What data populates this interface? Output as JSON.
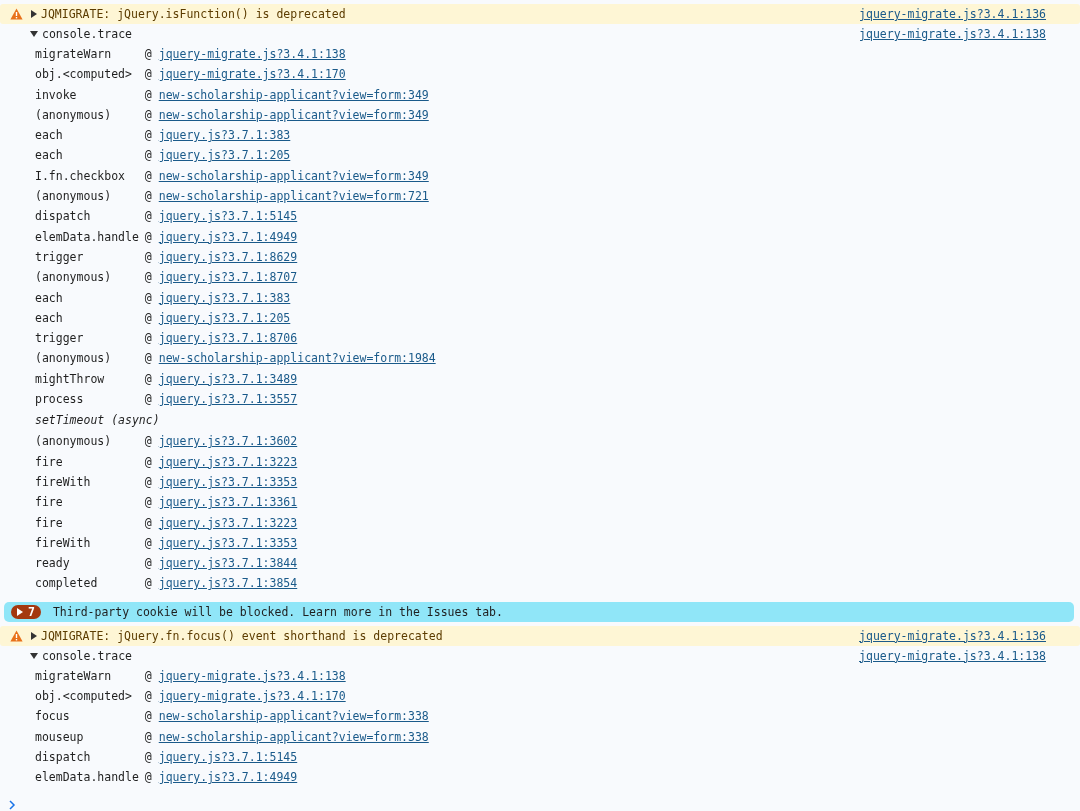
{
  "console_messages": [
    {
      "kind": "warning",
      "expanded": false,
      "message": "JQMIGRATE: jQuery.isFunction() is deprecated",
      "source": "jquery-migrate.js?3.4.1:136",
      "trace": {
        "label": "console.trace",
        "expanded": true,
        "source": "jquery-migrate.js?3.4.1:138",
        "frames": [
          {
            "kind": "frame",
            "function": "migrateWarn",
            "at": "@",
            "link": "jquery-migrate.js?3.4.1:138"
          },
          {
            "kind": "frame",
            "function": "obj.<computed>",
            "at": "@",
            "link": "jquery-migrate.js?3.4.1:170"
          },
          {
            "kind": "frame",
            "function": "invoke",
            "at": "@",
            "link": "new-scholarship-applicant?view=form:349"
          },
          {
            "kind": "frame",
            "function": "(anonymous)",
            "at": "@",
            "link": "new-scholarship-applicant?view=form:349"
          },
          {
            "kind": "frame",
            "function": "each",
            "at": "@",
            "link": "jquery.js?3.7.1:383"
          },
          {
            "kind": "frame",
            "function": "each",
            "at": "@",
            "link": "jquery.js?3.7.1:205"
          },
          {
            "kind": "frame",
            "function": "I.fn.checkbox",
            "at": "@",
            "link": "new-scholarship-applicant?view=form:349"
          },
          {
            "kind": "frame",
            "function": "(anonymous)",
            "at": "@",
            "link": "new-scholarship-applicant?view=form:721"
          },
          {
            "kind": "frame",
            "function": "dispatch",
            "at": "@",
            "link": "jquery.js?3.7.1:5145"
          },
          {
            "kind": "frame",
            "function": "elemData.handle",
            "at": "@",
            "link": "jquery.js?3.7.1:4949"
          },
          {
            "kind": "frame",
            "function": "trigger",
            "at": "@",
            "link": "jquery.js?3.7.1:8629"
          },
          {
            "kind": "frame",
            "function": "(anonymous)",
            "at": "@",
            "link": "jquery.js?3.7.1:8707"
          },
          {
            "kind": "frame",
            "function": "each",
            "at": "@",
            "link": "jquery.js?3.7.1:383"
          },
          {
            "kind": "frame",
            "function": "each",
            "at": "@",
            "link": "jquery.js?3.7.1:205"
          },
          {
            "kind": "frame",
            "function": "trigger",
            "at": "@",
            "link": "jquery.js?3.7.1:8706"
          },
          {
            "kind": "frame",
            "function": "(anonymous)",
            "at": "@",
            "link": "new-scholarship-applicant?view=form:1984"
          },
          {
            "kind": "frame",
            "function": "mightThrow",
            "at": "@",
            "link": "jquery.js?3.7.1:3489"
          },
          {
            "kind": "frame",
            "function": "process",
            "at": "@",
            "link": "jquery.js?3.7.1:3557"
          },
          {
            "kind": "async",
            "function": "setTimeout (async)"
          },
          {
            "kind": "frame",
            "function": "(anonymous)",
            "at": "@",
            "link": "jquery.js?3.7.1:3602"
          },
          {
            "kind": "frame",
            "function": "fire",
            "at": "@",
            "link": "jquery.js?3.7.1:3223"
          },
          {
            "kind": "frame",
            "function": "fireWith",
            "at": "@",
            "link": "jquery.js?3.7.1:3353"
          },
          {
            "kind": "frame",
            "function": "fire",
            "at": "@",
            "link": "jquery.js?3.7.1:3361"
          },
          {
            "kind": "frame",
            "function": "fire",
            "at": "@",
            "link": "jquery.js?3.7.1:3223"
          },
          {
            "kind": "frame",
            "function": "fireWith",
            "at": "@",
            "link": "jquery.js?3.7.1:3353"
          },
          {
            "kind": "frame",
            "function": "ready",
            "at": "@",
            "link": "jquery.js?3.7.1:3844"
          },
          {
            "kind": "frame",
            "function": "completed",
            "at": "@",
            "link": "jquery.js?3.7.1:3854"
          }
        ]
      }
    },
    {
      "kind": "issue",
      "count": "7",
      "message": "Third-party cookie will be blocked. Learn more in the Issues tab."
    },
    {
      "kind": "warning",
      "expanded": false,
      "message": "JQMIGRATE: jQuery.fn.focus() event shorthand is deprecated",
      "source": "jquery-migrate.js?3.4.1:136",
      "trace": {
        "label": "console.trace",
        "expanded": true,
        "source": "jquery-migrate.js?3.4.1:138",
        "frames": [
          {
            "kind": "frame",
            "function": "migrateWarn",
            "at": "@",
            "link": "jquery-migrate.js?3.4.1:138"
          },
          {
            "kind": "frame",
            "function": "obj.<computed>",
            "at": "@",
            "link": "jquery-migrate.js?3.4.1:170"
          },
          {
            "kind": "frame",
            "function": "focus",
            "at": "@",
            "link": "new-scholarship-applicant?view=form:338"
          },
          {
            "kind": "frame",
            "function": "mouseup",
            "at": "@",
            "link": "new-scholarship-applicant?view=form:338"
          },
          {
            "kind": "frame",
            "function": "dispatch",
            "at": "@",
            "link": "jquery.js?3.7.1:5145"
          },
          {
            "kind": "frame",
            "function": "elemData.handle",
            "at": "@",
            "link": "jquery.js?3.7.1:4949"
          }
        ]
      }
    }
  ]
}
